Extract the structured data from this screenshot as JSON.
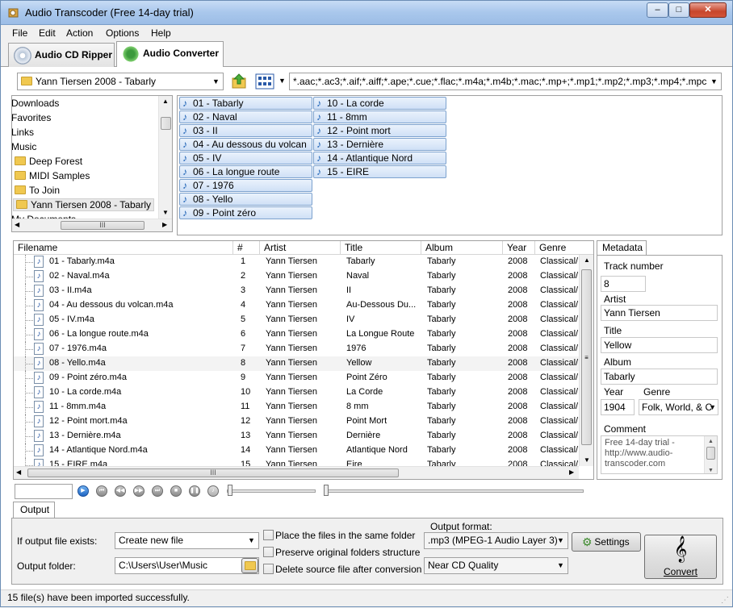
{
  "window": {
    "title": "Audio Transcoder (Free 14-day trial)"
  },
  "menu": [
    "File",
    "Edit",
    "Action",
    "Options",
    "Help"
  ],
  "tabs": [
    {
      "label": "Audio CD Ripper",
      "active": false
    },
    {
      "label": "Audio Converter",
      "active": true
    }
  ],
  "folder_combo": "Yann Tiersen 2008 - Tabarly",
  "filter_combo": "*.aac;*.ac3;*.aif;*.aiff;*.ape;*.cue;*.flac;*.m4a;*.m4b;*.mac;*.mp+;*.mp1;*.mp2;*.mp3;*.mp4;*.mpc",
  "tree": {
    "items": [
      "Downloads",
      "Favorites",
      "Links",
      "Music",
      "Deep Forest",
      "MIDI Samples",
      "To Join",
      "Yann Tiersen 2008 - Tabarly",
      "My Documents"
    ],
    "selected": "Yann Tiersen 2008 - Tabarly"
  },
  "tracks": [
    "01 - Tabarly",
    "02 - Naval",
    "03 - II",
    "04 - Au dessous du volcan",
    "05 - IV",
    "06 - La longue route",
    "07 - 1976",
    "08 - Yello",
    "09 - Point zéro",
    "10 - La corde",
    "11 - 8mm",
    "12 - Point mort",
    "13 - Dernière",
    "14 - Atlantique Nord",
    "15 - EIRE"
  ],
  "grid": {
    "columns": [
      "Filename",
      "#",
      "Artist",
      "Title",
      "Album",
      "Year",
      "Genre"
    ],
    "rows": [
      [
        "01 - Tabarly.m4a",
        "1",
        "Yann Tiersen",
        "Tabarly",
        "Tabarly",
        "2008",
        "Classical/..."
      ],
      [
        "02 - Naval.m4a",
        "2",
        "Yann Tiersen",
        "Naval",
        "Tabarly",
        "2008",
        "Classical/..."
      ],
      [
        "03 - II.m4a",
        "3",
        "Yann Tiersen",
        "II",
        "Tabarly",
        "2008",
        "Classical/..."
      ],
      [
        "04 - Au dessous du volcan.m4a",
        "4",
        "Yann Tiersen",
        "Au-Dessous Du...",
        "Tabarly",
        "2008",
        "Classical/..."
      ],
      [
        "05 - IV.m4a",
        "5",
        "Yann Tiersen",
        "IV",
        "Tabarly",
        "2008",
        "Classical/..."
      ],
      [
        "06 - La longue route.m4a",
        "6",
        "Yann Tiersen",
        "La Longue Route",
        "Tabarly",
        "2008",
        "Classical/..."
      ],
      [
        "07 - 1976.m4a",
        "7",
        "Yann Tiersen",
        "1976",
        "Tabarly",
        "2008",
        "Classical/..."
      ],
      [
        "08 - Yello.m4a",
        "8",
        "Yann Tiersen",
        "Yellow",
        "Tabarly",
        "2008",
        "Classical/..."
      ],
      [
        "09 - Point zéro.m4a",
        "9",
        "Yann Tiersen",
        "Point Zéro",
        "Tabarly",
        "2008",
        "Classical/..."
      ],
      [
        "10 - La corde.m4a",
        "10",
        "Yann Tiersen",
        "La Corde",
        "Tabarly",
        "2008",
        "Classical/..."
      ],
      [
        "11 - 8mm.m4a",
        "11",
        "Yann Tiersen",
        "8 mm",
        "Tabarly",
        "2008",
        "Classical/..."
      ],
      [
        "12 - Point mort.m4a",
        "12",
        "Yann Tiersen",
        "Point Mort",
        "Tabarly",
        "2008",
        "Classical/..."
      ],
      [
        "13 - Dernière.m4a",
        "13",
        "Yann Tiersen",
        "Dernière",
        "Tabarly",
        "2008",
        "Classical/..."
      ],
      [
        "14 - Atlantique Nord.m4a",
        "14",
        "Yann Tiersen",
        "Atlantique Nord",
        "Tabarly",
        "2008",
        "Classical/..."
      ],
      [
        "15 - EIRE.m4a",
        "15",
        "Yann Tiersen",
        "Eire",
        "Tabarly",
        "2008",
        "Classical/..."
      ]
    ],
    "selected_row": 7
  },
  "metadata": {
    "tab": "Metadata",
    "track_label": "Track number",
    "track": "8",
    "artist_label": "Artist",
    "artist": "Yann Tiersen",
    "title_label": "Title",
    "title": "Yellow",
    "album_label": "Album",
    "album": "Tabarly",
    "year_label": "Year",
    "year": "1904",
    "genre_label": "Genre",
    "genre": "Folk, World, & C",
    "comment_label": "Comment",
    "comment": "Free 14-day trial - http://www.audio-transcoder.com"
  },
  "output": {
    "tab": "Output",
    "exists_label": "If output file exists:",
    "exists_value": "Create new file",
    "folder_label": "Output folder:",
    "folder_value": "C:\\Users\\User\\Music",
    "chk_same_folder": "Place the files in the same folder",
    "chk_preserve": "Preserve original folders structure",
    "chk_delete": "Delete source file after conversion",
    "format_label": "Output format:",
    "format_value": ".mp3 (MPEG-1 Audio Layer 3)",
    "quality_value": "Near CD Quality",
    "settings_label": "Settings",
    "convert_label": "Convert"
  },
  "status": "15 file(s) have been imported successfully."
}
